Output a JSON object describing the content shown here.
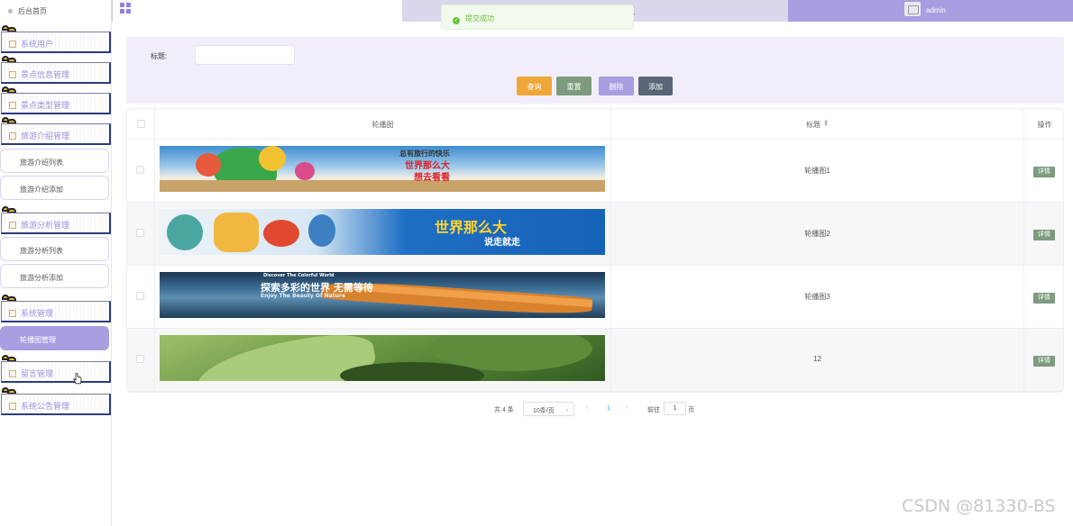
{
  "header": {
    "home_label": "后台首页",
    "system_title": "旅游信息管理系统",
    "username": "admin"
  },
  "toast": {
    "message": "提交成功"
  },
  "sidebar": {
    "items": [
      {
        "label": "系统用户",
        "type": "parent"
      },
      {
        "label": "景点信息管理",
        "type": "parent"
      },
      {
        "label": "景点类型管理",
        "type": "parent"
      },
      {
        "label": "旅游介绍管理",
        "type": "parent"
      },
      {
        "label": "旅游介绍列表",
        "type": "child"
      },
      {
        "label": "旅游介绍添加",
        "type": "child"
      },
      {
        "label": "旅游分析管理",
        "type": "parent"
      },
      {
        "label": "旅游分析列表",
        "type": "child"
      },
      {
        "label": "旅游分析添加",
        "type": "child"
      },
      {
        "label": "系统管理",
        "type": "parent"
      },
      {
        "label": "轮播图管理",
        "type": "child",
        "active": true
      },
      {
        "label": "留言管理",
        "type": "parent"
      },
      {
        "label": "系统公告管理",
        "type": "parent"
      }
    ]
  },
  "search": {
    "title_label": "标题:",
    "title_value": "",
    "buttons": {
      "query": "查询",
      "reset": "重置",
      "delete": "删除",
      "add": "添加"
    }
  },
  "table": {
    "headers": {
      "image": "轮播图",
      "title": "标题",
      "action": "操作"
    },
    "rows": [
      {
        "title": "轮播图1",
        "banner_text": "总有旅行的快乐",
        "banner_text2": "世界那么大",
        "banner_text3": "想去看看",
        "action": "详情"
      },
      {
        "title": "轮播图2",
        "banner_text": "世界那么大",
        "banner_text2": "说走就走",
        "action": "详情"
      },
      {
        "title": "轮播图3",
        "banner_text": "探索多彩的世界 无需等待",
        "banner_text2": "Discover The Colorful World",
        "banner_text3": "Enjoy The Beauty Of Nature",
        "action": "详情"
      },
      {
        "title": "12",
        "action": "详情"
      }
    ]
  },
  "pagination": {
    "total": "共 4 条",
    "page_size": "10条/页",
    "current_page": "1",
    "goto_label": "前往",
    "goto_value": "1",
    "page_suffix": "页"
  },
  "watermark": "CSDN @81330-BS",
  "colors": {
    "accent": "#a89ee0",
    "query": "#f0a73a",
    "reset": "#7d9b7d",
    "delete": "#a89ee0",
    "add": "#5a6677",
    "success": "#67c23a"
  }
}
